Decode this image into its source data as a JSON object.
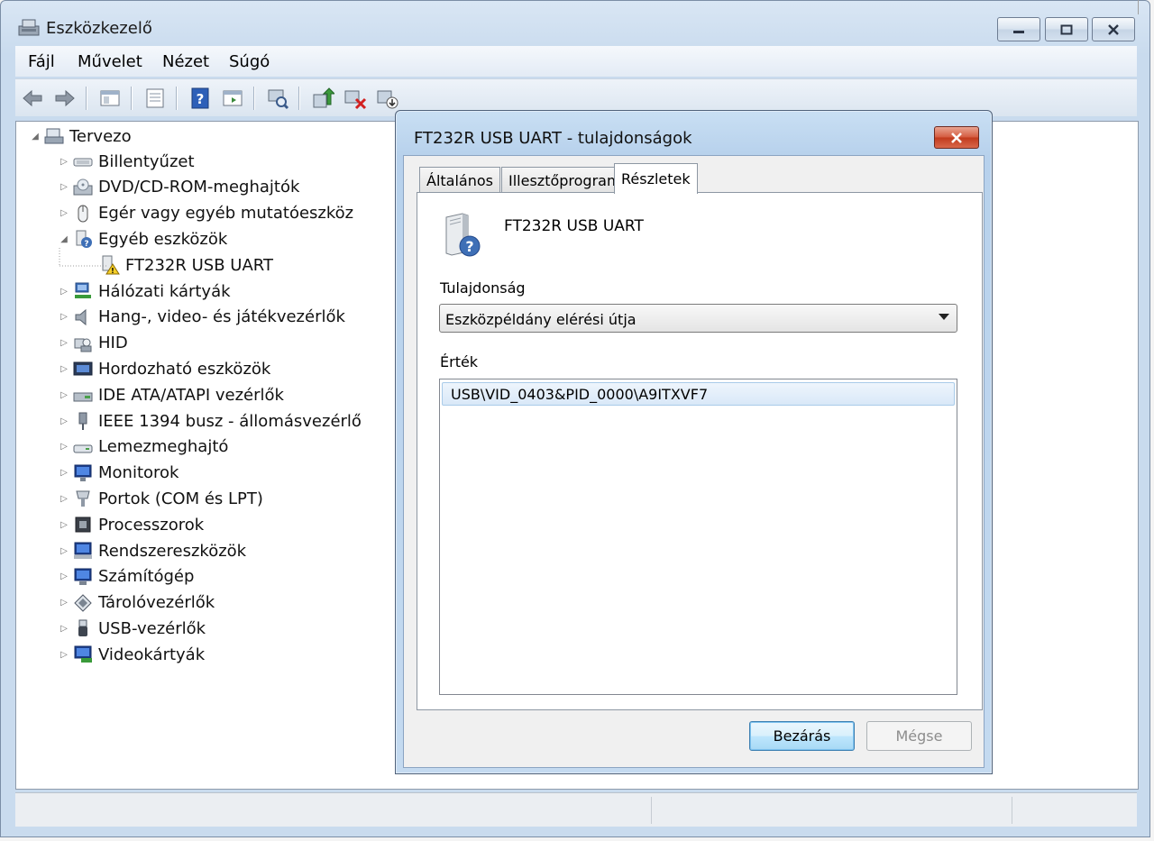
{
  "window": {
    "title": "Eszközkezelő"
  },
  "menu": [
    "Fájl",
    "Művelet",
    "Nézet",
    "Súgó"
  ],
  "toolbar": {
    "icons": [
      "back-arrow-icon",
      "forward-arrow-icon",
      "console-tree-icon",
      "properties-icon",
      "help-icon",
      "action-pane-icon",
      "scan-hardware-icon",
      "update-driver-icon",
      "disable-device-icon",
      "uninstall-device-icon"
    ]
  },
  "tree": {
    "root": "Tervezo",
    "items": [
      {
        "label": "Billentyűzet",
        "icon": "keyboard-icon",
        "state": "collapsed"
      },
      {
        "label": "DVD/CD-ROM-meghajtók",
        "icon": "dvd-drive-icon",
        "state": "collapsed"
      },
      {
        "label": "Egér vagy egyéb mutatóeszköz",
        "icon": "mouse-icon",
        "state": "collapsed"
      },
      {
        "label": "Egyéb eszközök",
        "icon": "unknown-device-icon",
        "state": "expanded"
      },
      {
        "label": "FT232R USB UART",
        "icon": "warning-device-icon",
        "state": "child"
      },
      {
        "label": "Hálózati kártyák",
        "icon": "network-adapter-icon",
        "state": "collapsed"
      },
      {
        "label": "Hang-, video- és játékvezérlők",
        "icon": "speaker-icon",
        "state": "collapsed"
      },
      {
        "label": "HID",
        "icon": "hid-icon",
        "state": "collapsed"
      },
      {
        "label": "Hordozható eszközök",
        "icon": "portable-device-icon",
        "state": "collapsed"
      },
      {
        "label": "IDE ATA/ATAPI vezérlők",
        "icon": "ide-controller-icon",
        "state": "collapsed"
      },
      {
        "label": "IEEE 1394 busz - állomásvezérlő",
        "icon": "firewire-icon",
        "state": "collapsed"
      },
      {
        "label": "Lemezmeghajtó",
        "icon": "disk-drive-icon",
        "state": "collapsed"
      },
      {
        "label": "Monitorok",
        "icon": "monitor-icon",
        "state": "collapsed"
      },
      {
        "label": "Portok (COM és LPT)",
        "icon": "port-icon",
        "state": "collapsed"
      },
      {
        "label": "Processzorok",
        "icon": "processor-icon",
        "state": "collapsed"
      },
      {
        "label": "Rendszereszközök",
        "icon": "system-device-icon",
        "state": "collapsed"
      },
      {
        "label": "Számítógép",
        "icon": "computer-icon",
        "state": "collapsed"
      },
      {
        "label": "Tárolóvezérlők",
        "icon": "storage-controller-icon",
        "state": "collapsed"
      },
      {
        "label": "USB-vezérlők",
        "icon": "usb-icon",
        "state": "collapsed"
      },
      {
        "label": "Videokártyák",
        "icon": "display-adapter-icon",
        "state": "collapsed"
      }
    ]
  },
  "dialog": {
    "title": "FT232R USB UART - tulajdonságok",
    "tabs": [
      "Általános",
      "Illesztőprogram",
      "Részletek"
    ],
    "active_tab": "Részletek",
    "device_name": "FT232R USB UART",
    "property_label": "Tulajdonság",
    "property_value": "Eszközpéldány elérési útja",
    "value_label": "Érték",
    "value_text": "USB\\VID_0403&PID_0000\\A9ITXVF7",
    "close_button": "Bezárás",
    "cancel_button": "Mégse"
  }
}
